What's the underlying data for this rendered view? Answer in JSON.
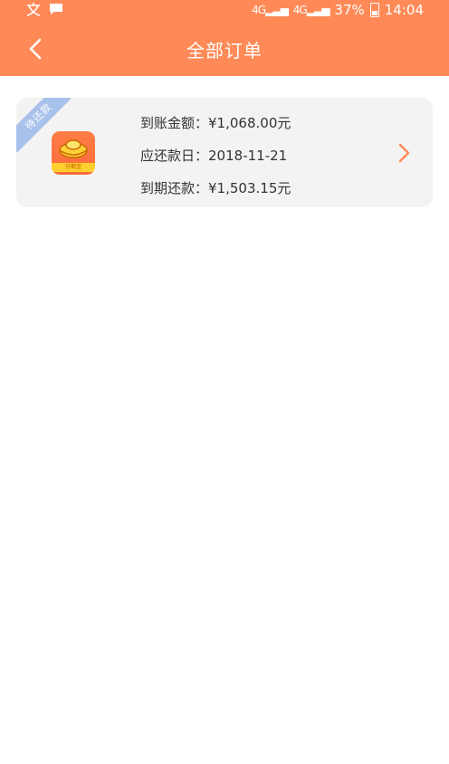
{
  "status_bar": {
    "left_icons": [
      "ime-icon",
      "chat-bubble-icon"
    ],
    "network_1": "4G",
    "network_2": "4G",
    "battery": "37%",
    "time": "14:04"
  },
  "header": {
    "title": "全部订单",
    "background": "#ff8a57"
  },
  "order": {
    "status_ribbon": "待还款",
    "app_name": "分期宝",
    "arrival_label": "到账金额：",
    "arrival_amount": "¥1,068.00元",
    "due_date_label": "应还款日：",
    "due_date": "2018-11-21",
    "repay_label": "到期还款：",
    "repay_amount": "¥1,503.15元",
    "accent": "#ff8a57"
  }
}
